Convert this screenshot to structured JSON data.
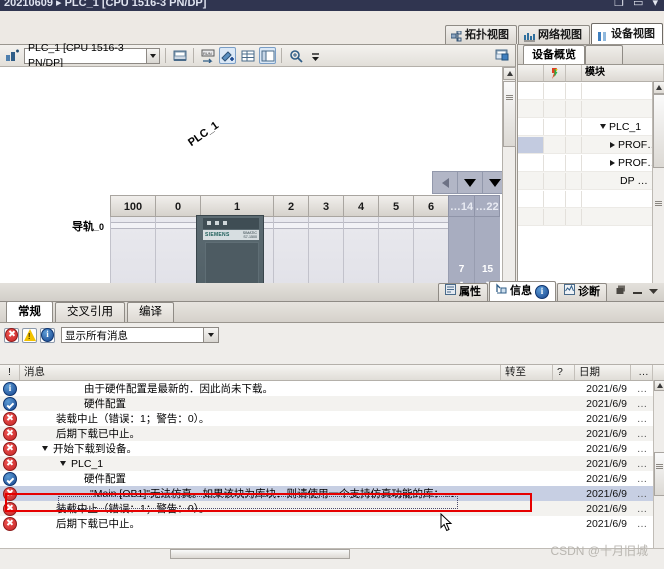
{
  "window": {
    "title": "20210609 ▸ PLC_1 [CPU 1516-3 PN/DP]",
    "controls": "❐ ▭ ▾"
  },
  "view_tabs": [
    {
      "label": "拓扑视图",
      "icon": "topology-icon",
      "active": false
    },
    {
      "label": "网络视图",
      "icon": "network-icon",
      "active": false
    },
    {
      "label": "设备视图",
      "icon": "device-icon",
      "active": true
    }
  ],
  "device_toolbar": {
    "device_select_value": "PLC_1 [CPU 1516-3 PN/DP]",
    "buttons": [
      {
        "name": "network-connect-button",
        "label": ""
      },
      {
        "name": "save-layout-button",
        "label": ""
      },
      {
        "name": "rearrange-button",
        "label": ""
      },
      {
        "name": "download-button",
        "label": ""
      },
      {
        "name": "grid-button",
        "label": ""
      },
      {
        "name": "overview-button",
        "label": ""
      },
      {
        "name": "zoom-button",
        "label": ""
      }
    ]
  },
  "rack": {
    "rail_label": "导轨",
    "rail_index": "_0",
    "device_label": "PLC_1",
    "slots": [
      "100",
      "0",
      "1",
      "2",
      "3",
      "4",
      "5",
      "6"
    ],
    "gray_slots": [
      {
        "header": "…14",
        "from": "7",
        "dash": "-",
        "to": "14"
      },
      {
        "header": "…22",
        "from": "15",
        "dash": "-",
        "to": "22"
      }
    ],
    "module_brand": "SIEMENS",
    "module_model": "SIMATIC\nS7-1500",
    "nav_left": "◀",
    "nav_down_1": "▼",
    "nav_down_2": "▼"
  },
  "device_overview": {
    "tab_label": "设备概览",
    "columns": [
      "",
      "",
      "",
      "模块"
    ],
    "rows": [
      {
        "name": "",
        "indent": 0,
        "expander": ""
      },
      {
        "name": "",
        "indent": 0,
        "expander": ""
      },
      {
        "name": "PLC_1",
        "indent": 1,
        "expander": "down"
      },
      {
        "name": "PROF…",
        "indent": 2,
        "expander": "right",
        "selected": true
      },
      {
        "name": "PROF…",
        "indent": 2,
        "expander": "right"
      },
      {
        "name": "DP …",
        "indent": 2,
        "expander": ""
      },
      {
        "name": "",
        "indent": 0,
        "expander": ""
      },
      {
        "name": "",
        "indent": 0,
        "expander": ""
      }
    ]
  },
  "inspector_tabs": [
    {
      "label": "属性",
      "icon": "properties-icon",
      "active": false,
      "badge": ""
    },
    {
      "label": "信息",
      "icon": "info-icon",
      "active": true,
      "badge": "i"
    },
    {
      "label": "诊断",
      "icon": "diagnostics-icon",
      "active": false,
      "badge": ""
    }
  ],
  "inspector_subtabs": [
    {
      "label": "常规",
      "active": true
    },
    {
      "label": "交叉引用",
      "active": false
    },
    {
      "label": "编译",
      "active": false
    }
  ],
  "filter": {
    "error_icon": "error-icon",
    "warning_icon": "warning-icon",
    "info_icon": "info-icon",
    "select_value": "显示所有消息"
  },
  "message_table": {
    "columns": {
      "status": "!",
      "message": "消息",
      "goto": "转至",
      "question": "?",
      "date": "日期",
      "more": "…"
    },
    "rows": [
      {
        "icon": "info",
        "indent": 4,
        "expander": "",
        "text": "由于硬件配置是最新的．因此尚未下载。",
        "goto": "",
        "q": "",
        "date": "2021/6/9",
        "more": "…",
        "selected": false
      },
      {
        "icon": "ok",
        "indent": 4,
        "expander": "",
        "text": "硬件配置",
        "goto": "",
        "q": "",
        "date": "2021/6/9",
        "more": "…",
        "selected": false
      },
      {
        "icon": "err",
        "indent": 2,
        "expander": "",
        "text": "装载中止（错误：1；警告：0）。",
        "goto": "",
        "q": "",
        "date": "2021/6/9",
        "more": "…",
        "selected": false
      },
      {
        "icon": "err",
        "indent": 2,
        "expander": "",
        "text": "后期下载已中止。",
        "goto": "",
        "q": "",
        "date": "2021/6/9",
        "more": "…",
        "selected": false
      },
      {
        "icon": "err",
        "indent": 1,
        "expander": "down",
        "text": "开始下载到设备。",
        "goto": "",
        "q": "",
        "date": "2021/6/9",
        "more": "…",
        "selected": false
      },
      {
        "icon": "err",
        "indent": 2,
        "expander": "down",
        "text": "PLC_1",
        "goto": "",
        "q": "",
        "date": "2021/6/9",
        "more": "…",
        "selected": false
      },
      {
        "icon": "ok",
        "indent": 4,
        "expander": "",
        "text": "硬件配置",
        "goto": "",
        "q": "",
        "date": "2021/6/9",
        "more": "…",
        "selected": false
      },
      {
        "icon": "err",
        "indent": 5,
        "expander": "",
        "text": "\"Main [OB1]\"无法仿真。如果该块为库块．则请使用一个支持仿真功能的库：…",
        "goto": "",
        "q": "",
        "date": "2021/6/9",
        "more": "…",
        "selected": true
      },
      {
        "icon": "err",
        "indent": 2,
        "expander": "",
        "text": "装载中止（错误：1；警告：0）。",
        "goto": "",
        "q": "",
        "date": "2021/6/9",
        "more": "…",
        "selected": false
      },
      {
        "icon": "err",
        "indent": 2,
        "expander": "",
        "text": "后期下载已中止。",
        "goto": "",
        "q": "",
        "date": "2021/6/9",
        "more": "…",
        "selected": false
      }
    ]
  },
  "watermark": "CSDN @十月旧城",
  "colors": {
    "title_bar": "#303550",
    "selection": "#c7cfe3",
    "highlight_box": "#e60000",
    "rack_gray": "#a8adc0",
    "port_green": "#2cd12c",
    "port_magenta": "#f02ad8"
  }
}
